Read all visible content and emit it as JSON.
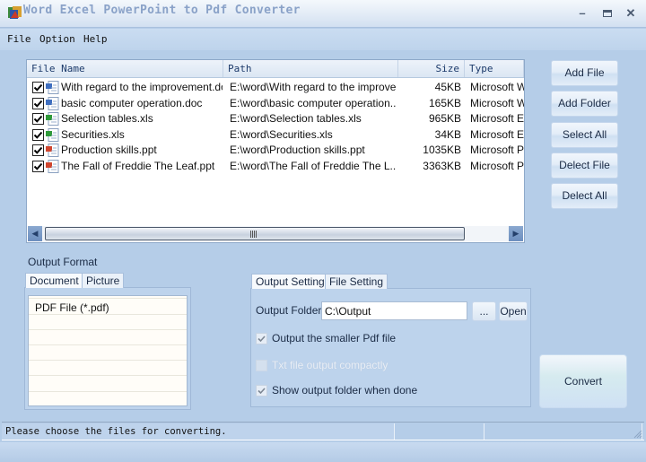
{
  "window": {
    "title": "Word Excel PowerPoint to Pdf Converter",
    "icon": "app-icon",
    "controls": [
      "minimize-icon",
      "maximize-icon",
      "close-icon"
    ]
  },
  "menu": {
    "items": [
      "File",
      "Option",
      "Help"
    ]
  },
  "file_list": {
    "columns": {
      "name": "File Name",
      "path": "Path",
      "size": "Size",
      "type": "Type"
    },
    "rows": [
      {
        "checked": true,
        "kind": "doc",
        "name": "With regard to the improvement.doc",
        "path": "E:\\word\\With regard to the improve...",
        "size": "45KB",
        "type": "Microsoft W"
      },
      {
        "checked": true,
        "kind": "doc",
        "name": "basic computer operation.doc",
        "path": "E:\\word\\basic computer operation....",
        "size": "165KB",
        "type": "Microsoft W"
      },
      {
        "checked": true,
        "kind": "xls",
        "name": "Selection tables.xls",
        "path": "E:\\word\\Selection tables.xls",
        "size": "965KB",
        "type": "Microsoft Ex"
      },
      {
        "checked": true,
        "kind": "xls",
        "name": "Securities.xls",
        "path": "E:\\word\\Securities.xls",
        "size": "34KB",
        "type": "Microsoft Ex"
      },
      {
        "checked": true,
        "kind": "ppt",
        "name": "Production skills.ppt",
        "path": "E:\\word\\Production skills.ppt",
        "size": "1035KB",
        "type": "Microsoft Pc"
      },
      {
        "checked": true,
        "kind": "ppt",
        "name": "The Fall of  Freddie The Leaf.ppt",
        "path": "E:\\word\\The Fall of  Freddie The L...",
        "size": "3363KB",
        "type": "Microsoft Pc"
      }
    ],
    "icon_colors": {
      "doc": "#3f6fc0",
      "xls": "#2f9a3a",
      "ppt": "#d0452e"
    }
  },
  "side_buttons": {
    "add_file": "Add File",
    "add_folder": "Add Folder",
    "select_all": "Select All",
    "delect_file": "Delect File",
    "delect_all": "Delect All"
  },
  "output_format": {
    "label": "Output Format",
    "tabs": [
      "Document",
      "Picture"
    ],
    "active_tab": "Document",
    "items": [
      "PDF File  (*.pdf)"
    ]
  },
  "settings": {
    "tabs": [
      "Output Setting",
      "File Setting"
    ],
    "active_tab": "Output Setting",
    "output_folder_label": "Output Folder",
    "output_folder_value": "C:\\Output",
    "browse_label": "...",
    "open_label": "Open",
    "options": [
      {
        "label": "Output the smaller Pdf file",
        "checked": true,
        "enabled": true
      },
      {
        "label": "Txt file output compactly",
        "checked": false,
        "enabled": false
      },
      {
        "label": "Show output folder when done",
        "checked": true,
        "enabled": true
      }
    ]
  },
  "convert_label": "Convert",
  "status": {
    "message": "Please choose the files for converting."
  }
}
